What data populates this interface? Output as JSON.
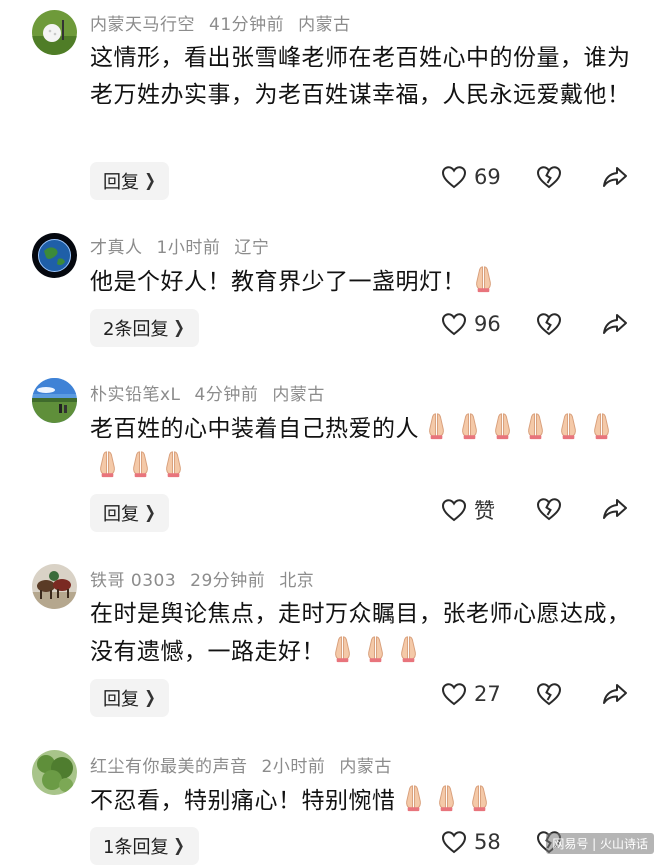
{
  "comments": [
    {
      "user": "内蒙天马行空",
      "time": "41分钟前",
      "location": "内蒙古",
      "avatar": "golf-ball-avatar",
      "text": "这情形，看出张雪峰老师在老百姓心中的份量，谁为老万姓办实事，为老百姓谋幸福，人民永远爱戴他！",
      "emoji_count": 0,
      "reply_label": "回复",
      "likes": "69"
    },
    {
      "user": "才真人",
      "time": "1小时前",
      "location": "辽宁",
      "avatar": "earth-avatar",
      "text": "他是个好人！教育界少了一盏明灯！",
      "emoji_count": 1,
      "reply_label": "2条回复",
      "likes": "96"
    },
    {
      "user": "朴实铅笔xL",
      "time": "4分钟前",
      "location": "内蒙古",
      "avatar": "landscape-avatar",
      "text": "老百姓的心中装着自己热爱的人",
      "emoji_count": 9,
      "reply_label": "回复",
      "likes": "赞"
    },
    {
      "user": "铁哥 0303",
      "time": "29分钟前",
      "location": "北京",
      "avatar": "horses-avatar",
      "text": "在时是舆论焦点，走时万众瞩目，张老师心愿达成，没有遗憾，一路走好！",
      "emoji_count": 3,
      "reply_label": "回复",
      "likes": "27"
    },
    {
      "user": "红尘有你最美的声音",
      "time": "2小时前",
      "location": "内蒙古",
      "avatar": "tree-avatar",
      "text": "不忍看，特别痛心！特别惋惜",
      "emoji_count": 3,
      "reply_label": "1条回复",
      "likes": "58"
    }
  ],
  "icons": {
    "like": "heart-icon",
    "dislike": "broken-heart-icon",
    "share": "share-arrow-icon",
    "emoji": "folded-hands-emoji",
    "chevron": "chevron-right-icon"
  },
  "watermark": "网易号 | 火山诗话",
  "colors": {
    "meta": "#8c8c8c",
    "button_bg": "#f3f3f3"
  }
}
